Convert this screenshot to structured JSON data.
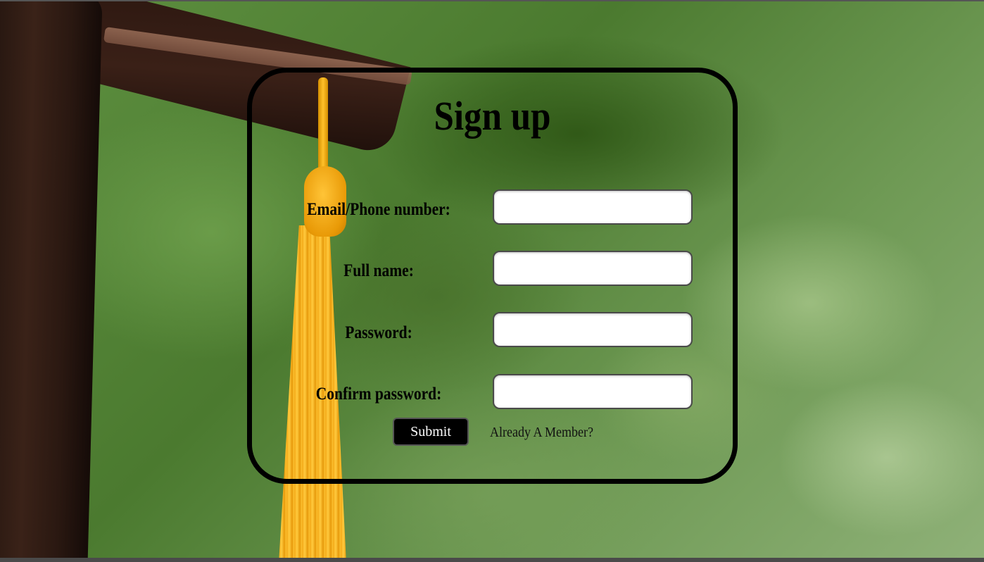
{
  "form": {
    "title": "Sign up",
    "fields": [
      {
        "label": "Email/Phone number:",
        "value": "",
        "placeholder": ""
      },
      {
        "label": "Full name:",
        "value": "",
        "placeholder": ""
      },
      {
        "label": "Password:",
        "value": "",
        "placeholder": ""
      },
      {
        "label": "Confirm password:",
        "value": "",
        "placeholder": ""
      }
    ],
    "submit_label": "Submit",
    "member_link": "Already A Member?"
  },
  "colors": {
    "card_border": "#000000",
    "button_bg": "#000000",
    "button_text": "#ffffff",
    "background_green": "#4f7a35",
    "tassel_gold": "#ffc12a"
  }
}
